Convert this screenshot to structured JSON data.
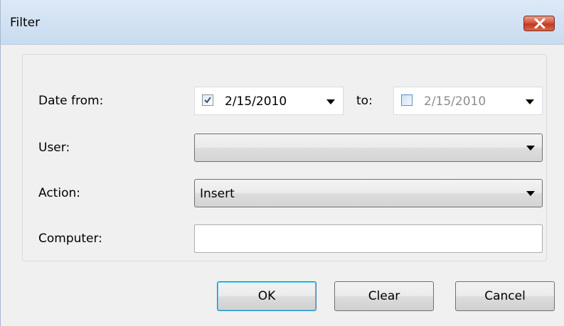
{
  "window": {
    "title": "Filter"
  },
  "form": {
    "date_from_label": "Date from:",
    "date_from_value": "2/15/2010",
    "date_from_checked": true,
    "to_label": "to:",
    "date_to_value": "2/15/2010",
    "date_to_checked": false,
    "user_label": "User:",
    "user_value": "",
    "action_label": "Action:",
    "action_value": "Insert",
    "computer_label": "Computer:",
    "computer_value": ""
  },
  "buttons": {
    "ok": "OK",
    "clear": "Clear",
    "cancel": "Cancel"
  },
  "icons": {
    "close": "close-icon",
    "checkbox": "checkmark-icon",
    "dropdown": "dropdown-arrow-icon"
  },
  "colors": {
    "title_gradient_top": "#dce9f7",
    "close_red": "#c0391f",
    "default_button_border": "#3c7fb1"
  }
}
